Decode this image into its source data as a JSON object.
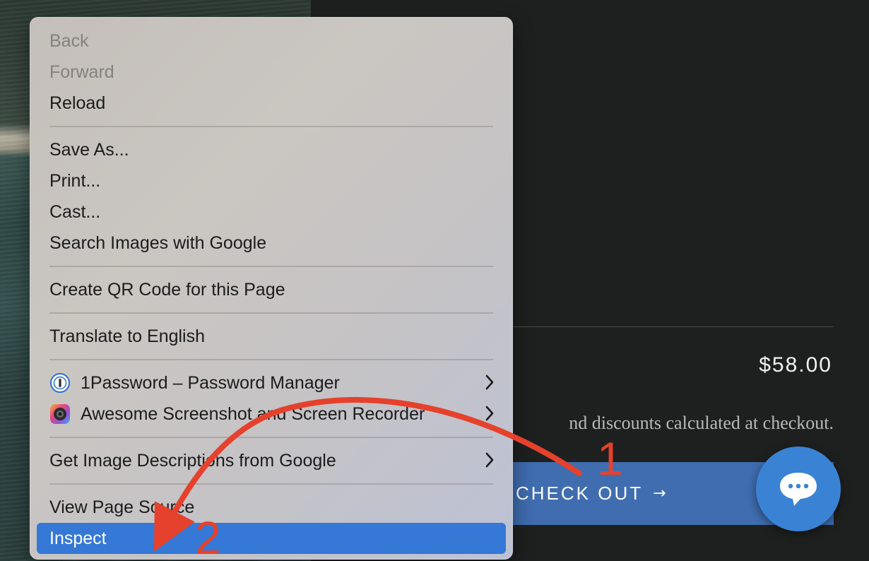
{
  "context_menu": {
    "items": [
      {
        "label": "Back",
        "disabled": true
      },
      {
        "label": "Forward",
        "disabled": true
      },
      {
        "label": "Reload"
      },
      {
        "label": "Save As..."
      },
      {
        "label": "Print..."
      },
      {
        "label": "Cast..."
      },
      {
        "label": "Search Images with Google"
      },
      {
        "label": "Create QR Code for this Page"
      },
      {
        "label": "Translate to English"
      },
      {
        "label": "1Password – Password Manager",
        "icon": "1password-icon",
        "submenu": true
      },
      {
        "label": "Awesome Screenshot and Screen Recorder",
        "icon": "awesome-screenshot-icon",
        "submenu": true
      },
      {
        "label": "Get Image Descriptions from Google",
        "submenu": true
      },
      {
        "label": "View Page Source"
      },
      {
        "label": "Inspect",
        "highlighted": true
      }
    ]
  },
  "cart": {
    "subtotal": "$58.00",
    "tax_note": "nd discounts calculated at checkout.",
    "checkout_label": "CHECK OUT",
    "checkout_arrow": "→"
  },
  "chat": {
    "icon": "chat-bubble-icon"
  },
  "annotations": {
    "step_1": "1",
    "step_2": "2",
    "color": "#e5412c"
  },
  "colors": {
    "menu_highlight": "#3578d6",
    "checkout_button": "#3f6db0",
    "chat_button": "#3a83d4"
  }
}
